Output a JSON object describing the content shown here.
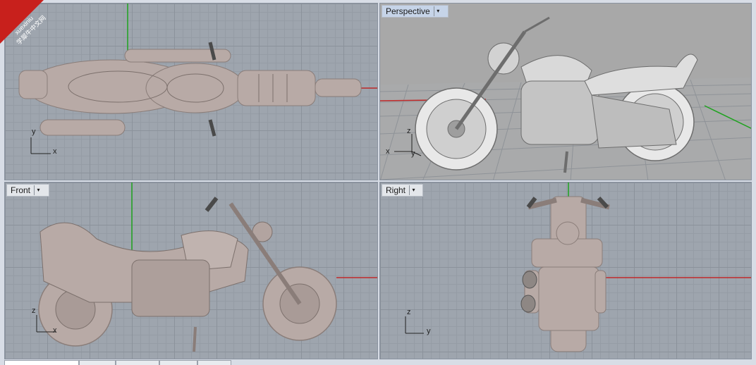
{
  "viewports": {
    "top": {
      "title": ""
    },
    "perspective": {
      "title": "Perspective",
      "dropdown": "▾"
    },
    "front": {
      "title": "Front",
      "dropdown": "▾"
    },
    "right": {
      "title": "Right",
      "dropdown": "▾"
    }
  },
  "axes": {
    "top": {
      "a": "y",
      "b": "x"
    },
    "perspective": {
      "a": "z",
      "b": "x",
      "c": "y"
    },
    "front": {
      "a": "z",
      "b": "x"
    },
    "right": {
      "a": "z",
      "b": "y"
    }
  },
  "watermark": {
    "line1": "xuexiniu",
    "line2": "学犀牛中文网"
  },
  "tabs": [
    "",
    "",
    "",
    "",
    ""
  ]
}
